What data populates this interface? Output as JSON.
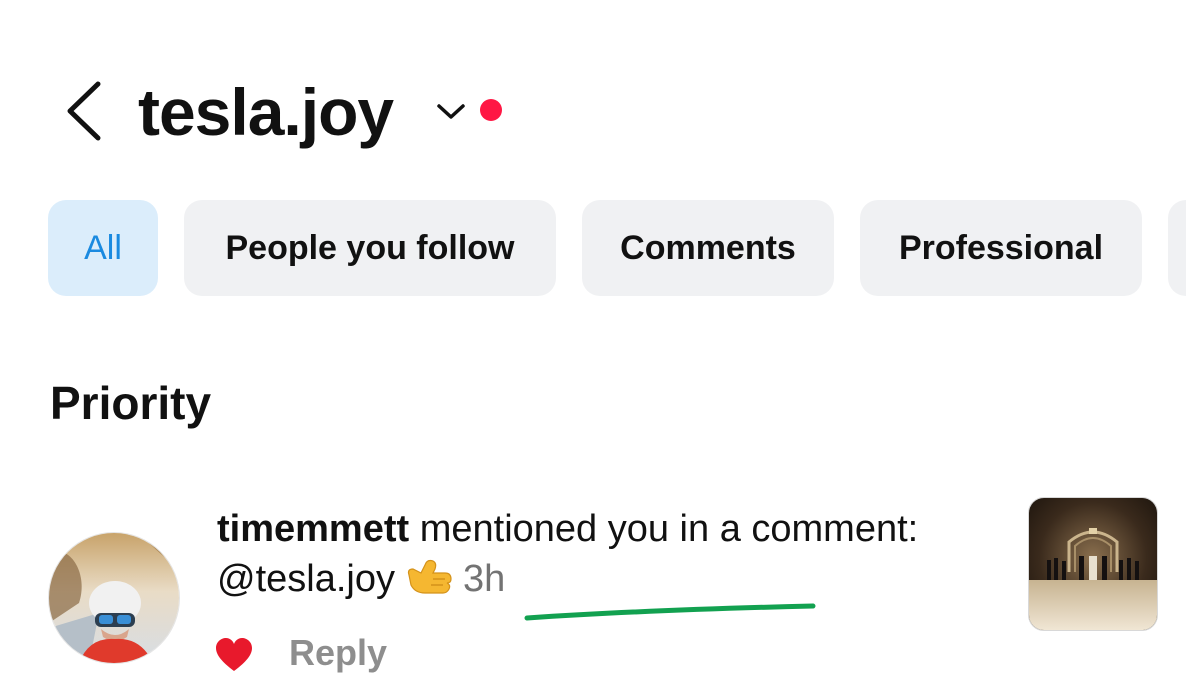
{
  "header": {
    "username": "tesla.joy",
    "back_icon": "chevron-left-icon",
    "switch_icon": "chevron-down-icon",
    "dot_color": "#ff1744"
  },
  "filters": {
    "items": [
      {
        "label": "All",
        "active": true
      },
      {
        "label": "People you follow",
        "active": false
      },
      {
        "label": "Comments",
        "active": false
      },
      {
        "label": "Professional",
        "active": false
      }
    ],
    "active_color": "#1a8ae0",
    "active_bg": "#dbedfb"
  },
  "section": {
    "title": "Priority"
  },
  "notification": {
    "username": "timemmett",
    "action": " mentioned you in a comment: @tesla.joy",
    "emoji": "call-me-hand-emoji",
    "time": "3h",
    "like_icon": "heart-icon",
    "like_color": "#e8192c",
    "reply_label": "Reply",
    "annotation_color": "#12a150"
  }
}
